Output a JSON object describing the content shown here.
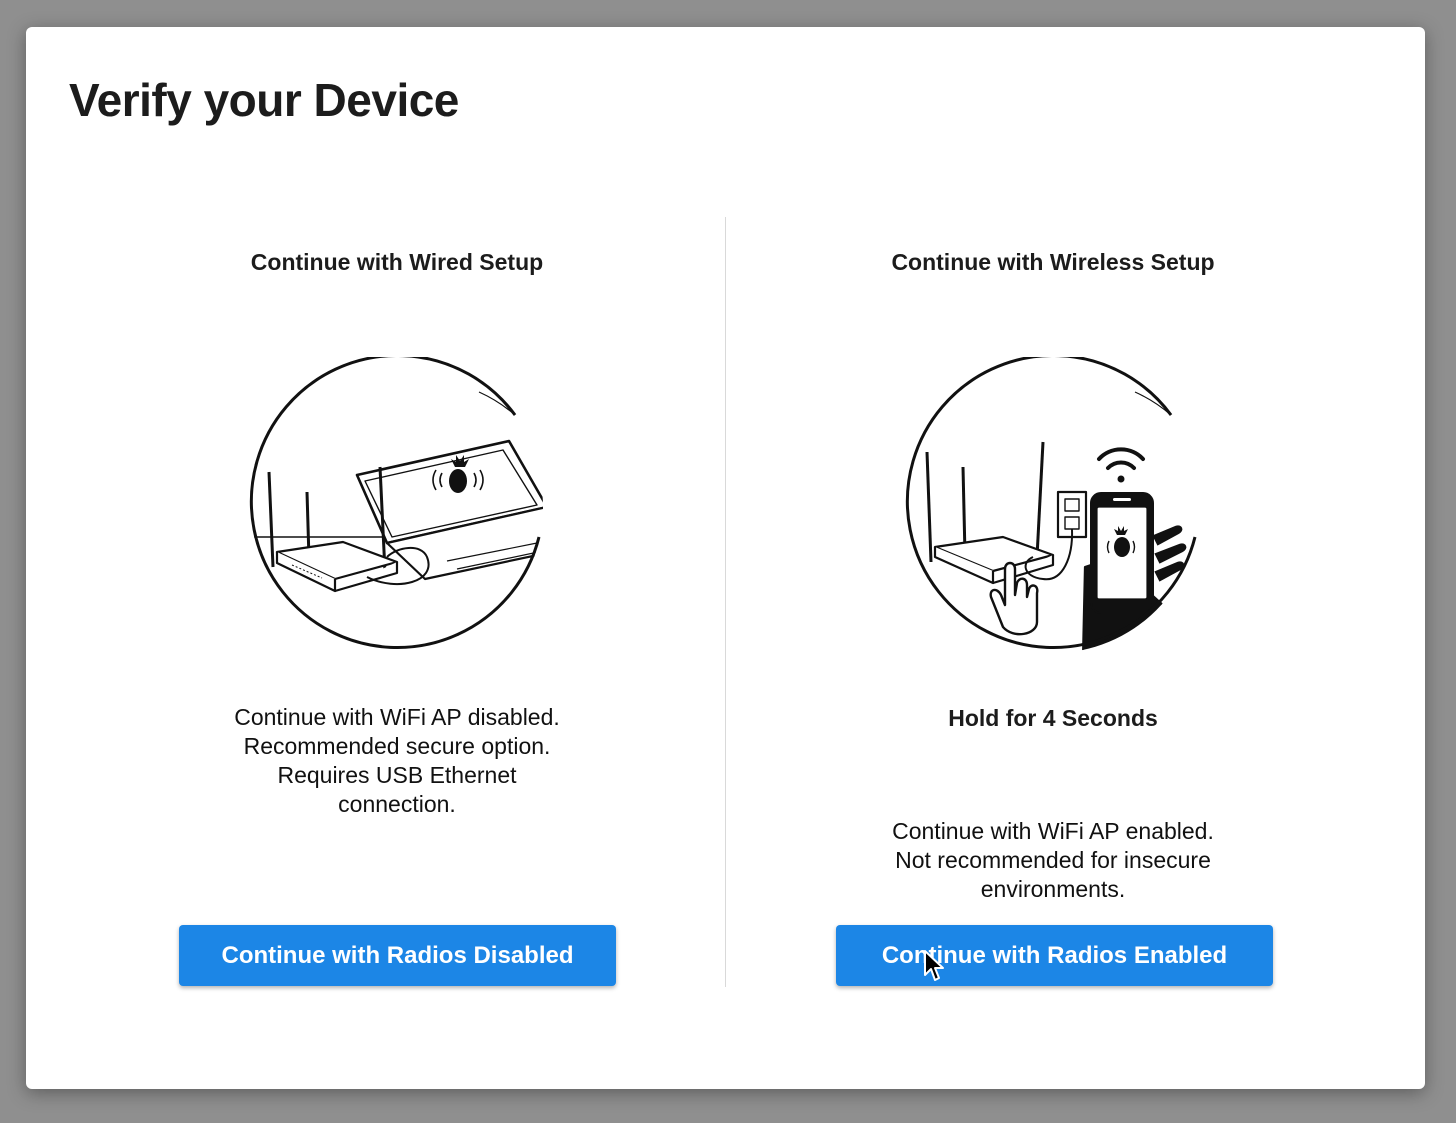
{
  "page": {
    "title": "Verify your Device"
  },
  "wired": {
    "heading": "Continue with Wired Setup",
    "description_lines": [
      "Continue with WiFi AP disabled.",
      "Recommended secure option.",
      "Requires USB Ethernet",
      "connection."
    ],
    "button_label": "Continue with Radios Disabled"
  },
  "wireless": {
    "heading": "Continue with Wireless Setup",
    "hold_label": "Hold for 4 Seconds",
    "description_lines": [
      "Continue with WiFi AP enabled.",
      "Not recommended for insecure",
      "environments."
    ],
    "button_label": "Continue with Radios Enabled"
  },
  "colors": {
    "accent": "#1c86e6",
    "background": "#8f8f8f",
    "card": "#ffffff"
  },
  "icons": [
    "pineapple-logo-icon",
    "wifi-icon",
    "pointer-cursor-icon"
  ]
}
